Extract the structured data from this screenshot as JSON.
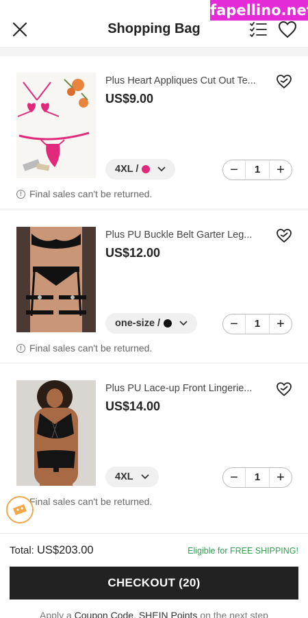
{
  "watermark": "fapellino.net",
  "header": {
    "title": "Shopping Bag",
    "close_icon": "close-icon",
    "list_icon": "checklist-icon",
    "wishlist_icon": "heart-icon"
  },
  "items": [
    {
      "name": "Plus Heart Appliques Cut Out Te...",
      "price": "US$9.00",
      "variant": "4XL /",
      "swatch_color": "#e0297a",
      "quantity": "1",
      "note": "Final sales can't be returned."
    },
    {
      "name": "Plus PU Buckle Belt Garter Leg...",
      "price": "US$12.00",
      "variant": "one-size /",
      "swatch_color": "#111111",
      "quantity": "1",
      "note": "Final sales can't be returned."
    },
    {
      "name": "Plus PU Lace-up Front Lingerie...",
      "price": "US$14.00",
      "variant": "4XL",
      "quantity": "1",
      "note": "Final sales can't be returned."
    }
  ],
  "footer": {
    "total_label": "Total:",
    "total_value": "US$203.00",
    "shipping_note": "Eligible for FREE SHIPPING!",
    "checkout_label": "CHECKOUT (20)",
    "hint_prefix": "Apply a",
    "hint_coupon": "Coupon Code",
    "hint_sep": ",",
    "hint_points": "SHEIN Points",
    "hint_suffix": "on the next step"
  },
  "colors": {
    "accent_green": "#2f9e4f",
    "checkout_bg": "#222222",
    "watermark_bg": "#e52ad7"
  }
}
